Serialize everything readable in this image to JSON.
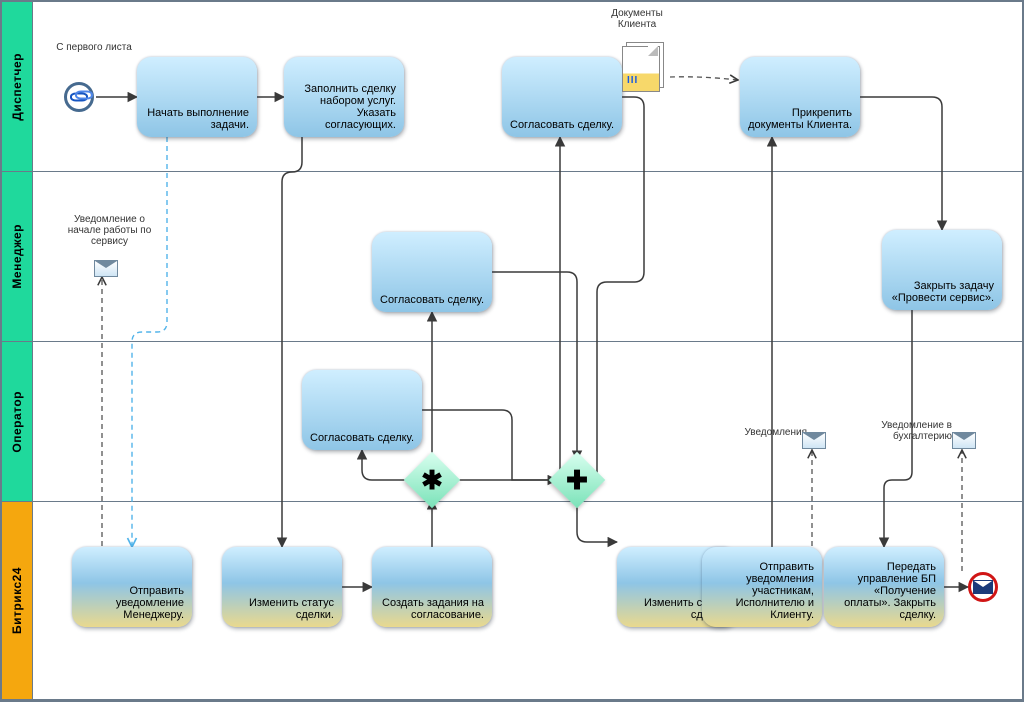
{
  "lanes": {
    "dispatcher": "Диспетчер",
    "manager": "Менеджер",
    "operator": "Оператор",
    "bitrix": "Битрикс24"
  },
  "labels": {
    "from_first_sheet": "С первого листа",
    "client_documents": "Документы Клиента",
    "notice_service_start": "Уведомление о начале работы по сервису",
    "notifications": "Уведомления",
    "notice_accounting": "Уведомление в бухгалтерию"
  },
  "tasks": {
    "d1": "Начать выполнение задачи.",
    "d2": "Заполнить сделку набором услуг. Указать согласующих.",
    "d3": "Согласовать сделку.",
    "d4": "Прикрепить документы Клиента.",
    "m1": "Согласовать сделку.",
    "m2": "Закрыть задачу «Провести сервис».",
    "o1": "Согласовать сделку.",
    "b1": "Отправить уведомление Менеджеру.",
    "b2": "Изменить статус сделки.",
    "b3": "Создать задания на согласование.",
    "b4": "Изменить статус сделки.",
    "b5": "Отправить уведомления участникам, Исполнителю и Клиенту.",
    "b6": "Передать управление БП «Получение оплаты». Закрыть сделку."
  }
}
